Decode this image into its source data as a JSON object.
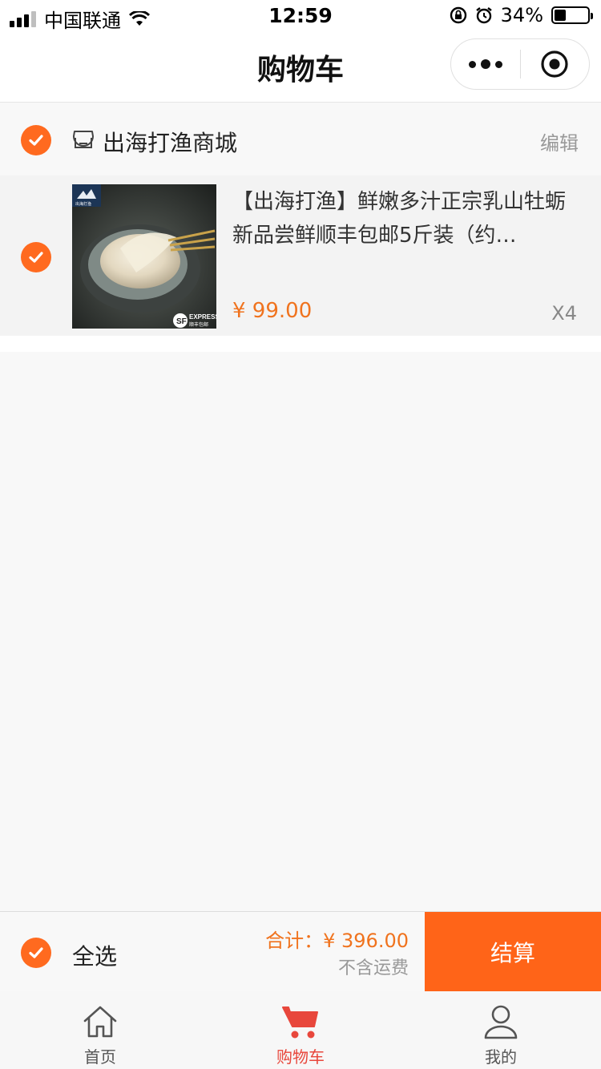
{
  "status_bar": {
    "carrier": "中国联通",
    "time": "12:59",
    "battery": "34%",
    "battery_level": 0.34
  },
  "nav": {
    "title": "购物车"
  },
  "shop": {
    "name": "出海打渔商城",
    "edit_label": "编辑"
  },
  "cart_items": [
    {
      "title": "【出海打渔】鲜嫩多汁正宗乳山牡蛎新品尝鲜顺丰包邮5斤装（约…",
      "price": "¥ 99.00",
      "quantity": "X4",
      "image_badge": "EXPRESS",
      "image_badge_sub": "顺丰包邮",
      "image_logo_text": "出海打渔"
    }
  ],
  "checkout": {
    "select_all_label": "全选",
    "total": "合计：¥ 396.00",
    "shipping_note": "不含运费",
    "checkout_label": "结算"
  },
  "tabs": [
    {
      "label": "首页",
      "icon": "home-icon"
    },
    {
      "label": "购物车",
      "icon": "cart-icon"
    },
    {
      "label": "我的",
      "icon": "user-icon"
    }
  ],
  "colors": {
    "accent": "#ff6418",
    "price": "#f0731e",
    "tab_active": "#e8473c"
  }
}
